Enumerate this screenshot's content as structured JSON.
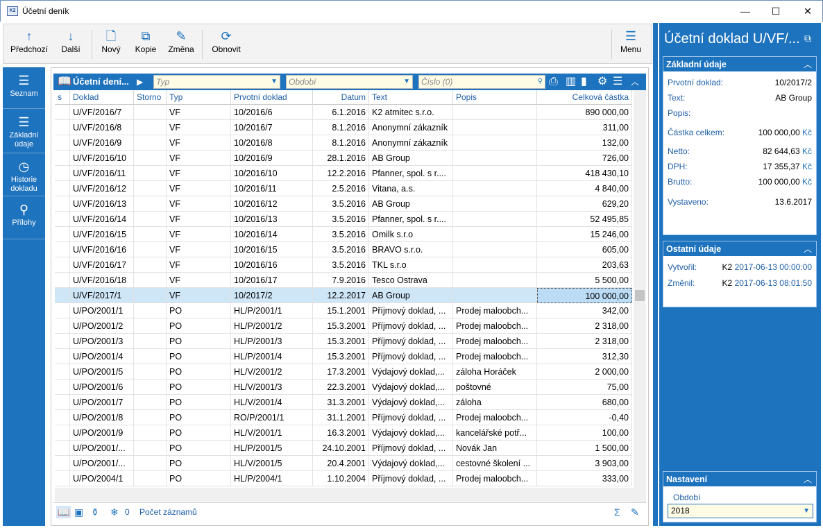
{
  "window": {
    "title": "Účetní deník",
    "app_icon": "K2",
    "minimize": "—",
    "maximize": "☐",
    "close": "✕"
  },
  "toolbar": {
    "buttons": [
      {
        "label": "Předchozí",
        "icon": "↑"
      },
      {
        "label": "Další",
        "icon": "↓"
      },
      {
        "label": "Nový",
        "icon": "🗋"
      },
      {
        "label": "Kopie",
        "icon": "⧉"
      },
      {
        "label": "Změna",
        "icon": "✎"
      },
      {
        "label": "Obnovit",
        "icon": "⟳"
      },
      {
        "label": "Menu",
        "icon": "☰"
      }
    ]
  },
  "nav": {
    "items": [
      {
        "label": "Seznam",
        "icon": "☰"
      },
      {
        "label": "Základní údaje",
        "icon": "☰"
      },
      {
        "label": "Historie dokladu",
        "icon": "◷"
      },
      {
        "label": "Přílohy",
        "icon": "⚲"
      }
    ]
  },
  "grid": {
    "title": "Účetní dení...",
    "filter_typ": "Typ",
    "filter_obdobi": "Období",
    "filter_cislo": "Číslo (0)",
    "columns": [
      "s",
      "Doklad",
      "Storno",
      "Typ",
      "Prvotní doklad",
      "Datum",
      "Text",
      "Popis",
      "Celková částka"
    ],
    "rows": [
      [
        "",
        "U/VF/2016/7",
        "",
        "VF",
        "10/2016/6",
        "6.1.2016",
        "K2 atmitec s.r.o.",
        "",
        "890 000,00"
      ],
      [
        "",
        "U/VF/2016/8",
        "",
        "VF",
        "10/2016/7",
        "8.1.2016",
        "Anonymní zákazník",
        "",
        "311,00"
      ],
      [
        "",
        "U/VF/2016/9",
        "",
        "VF",
        "10/2016/8",
        "8.1.2016",
        "Anonymní zákazník",
        "",
        "132,00"
      ],
      [
        "",
        "U/VF/2016/10",
        "",
        "VF",
        "10/2016/9",
        "28.1.2016",
        "AB Group",
        "",
        "726,00"
      ],
      [
        "",
        "U/VF/2016/11",
        "",
        "VF",
        "10/2016/10",
        "12.2.2016",
        "Pfanner, spol. s r....",
        "",
        "418 430,10"
      ],
      [
        "",
        "U/VF/2016/12",
        "",
        "VF",
        "10/2016/11",
        "2.5.2016",
        "Vitana, a.s.",
        "",
        "4 840,00"
      ],
      [
        "",
        "U/VF/2016/13",
        "",
        "VF",
        "10/2016/12",
        "3.5.2016",
        "AB Group",
        "",
        "629,20"
      ],
      [
        "",
        "U/VF/2016/14",
        "",
        "VF",
        "10/2016/13",
        "3.5.2016",
        "Pfanner, spol. s r....",
        "",
        "52 495,85"
      ],
      [
        "",
        "U/VF/2016/15",
        "",
        "VF",
        "10/2016/14",
        "3.5.2016",
        "Omilk s.r.o",
        "",
        "15 246,00"
      ],
      [
        "",
        "U/VF/2016/16",
        "",
        "VF",
        "10/2016/15",
        "3.5.2016",
        "BRAVO s.r.o.",
        "",
        "605,00"
      ],
      [
        "",
        "U/VF/2016/17",
        "",
        "VF",
        "10/2016/16",
        "3.5.2016",
        "TKL s.r.o",
        "",
        "203,63"
      ],
      [
        "",
        "U/VF/2016/18",
        "",
        "VF",
        "10/2016/17",
        "7.9.2016",
        "Tesco Ostrava",
        "",
        "5 500,00"
      ],
      [
        "",
        "U/VF/2017/1",
        "",
        "VF",
        "10/2017/2",
        "12.2.2017",
        "AB Group",
        "",
        "100 000,00"
      ],
      [
        "",
        "U/PO/2001/1",
        "",
        "PO",
        "HL/P/2001/1",
        "15.1.2001",
        "Příjmový doklad, ...",
        "Prodej maloobch...",
        "342,00"
      ],
      [
        "",
        "U/PO/2001/2",
        "",
        "PO",
        "HL/P/2001/2",
        "15.3.2001",
        "Příjmový doklad, ...",
        "Prodej maloobch...",
        "2 318,00"
      ],
      [
        "",
        "U/PO/2001/3",
        "",
        "PO",
        "HL/P/2001/3",
        "15.3.2001",
        "Příjmový doklad, ...",
        "Prodej maloobch...",
        "2 318,00"
      ],
      [
        "",
        "U/PO/2001/4",
        "",
        "PO",
        "HL/P/2001/4",
        "15.3.2001",
        "Příjmový doklad, ...",
        "Prodej maloobch...",
        "312,30"
      ],
      [
        "",
        "U/PO/2001/5",
        "",
        "PO",
        "HL/V/2001/2",
        "17.3.2001",
        "Výdajový doklad,...",
        "záloha Horáček",
        "2 000,00"
      ],
      [
        "",
        "U/PO/2001/6",
        "",
        "PO",
        "HL/V/2001/3",
        "22.3.2001",
        "Výdajový doklad,...",
        "poštovné",
        "75,00"
      ],
      [
        "",
        "U/PO/2001/7",
        "",
        "PO",
        "HL/V/2001/4",
        "31.3.2001",
        "Výdajový doklad,...",
        "záloha",
        "680,00"
      ],
      [
        "",
        "U/PO/2001/8",
        "",
        "PO",
        "RO/P/2001/1",
        "31.1.2001",
        "Příjmový doklad, ...",
        "Prodej maloobch...",
        "-0,40"
      ],
      [
        "",
        "U/PO/2001/9",
        "",
        "PO",
        "HL/V/2001/1",
        "16.3.2001",
        "Výdajový doklad,...",
        "kancelářské potř...",
        "100,00"
      ],
      [
        "",
        "U/PO/2001/...",
        "",
        "PO",
        "HL/P/2001/5",
        "24.10.2001",
        "Příjmový doklad, ...",
        "Novák Jan",
        "1 500,00"
      ],
      [
        "",
        "U/PO/2001/...",
        "",
        "PO",
        "HL/V/2001/5",
        "20.4.2001",
        "Výdajový doklad,...",
        "cestovné školení ...",
        "3 903,00"
      ],
      [
        "",
        "U/PO/2004/1",
        "",
        "PO",
        "HL/P/2004/1",
        "1.10.2004",
        "Příjmový doklad, ...",
        "Prodej maloobch...",
        "333,00"
      ]
    ],
    "selected_row": 12
  },
  "status": {
    "count": "0",
    "label": "Počet záznamů",
    "sum_icon": "Σ",
    "edit_icon": "✎"
  },
  "detail": {
    "title": "Účetní doklad U/VF/...",
    "zakladni": {
      "header": "Základní údaje",
      "prvotni_label": "Prvotní doklad:",
      "prvotni_value": "10/2017/2",
      "text_label": "Text:",
      "text_value": "AB Group",
      "popis_label": "Popis:",
      "castka_label": "Částka celkem:",
      "castka_value": "100 000,00",
      "netto_label": "Netto:",
      "netto_value": "82 644,63",
      "dph_label": "DPH:",
      "dph_value": "17 355,37",
      "brutto_label": "Brutto:",
      "brutto_value": "100 000,00",
      "currency": "Kč",
      "vystaveno_label": "Vystaveno:",
      "vystaveno_value": "13.6.2017"
    },
    "ostatni": {
      "header": "Ostatní údaje",
      "vytvoril_label": "Vytvořil:",
      "vytvoril_user": "K2",
      "vytvoril_time": "2017-06-13 00:00:00",
      "zmenil_label": "Změnil:",
      "zmenil_user": "K2",
      "zmenil_time": "2017-06-13 08:01:50"
    },
    "nastaveni": {
      "header": "Nastavení",
      "obdobi_label": "Období",
      "obdobi_value": "2018"
    }
  },
  "colors": {
    "accent": "#1e73be",
    "selection": "#cfe6f7",
    "filter_bg": "#fffce6"
  }
}
